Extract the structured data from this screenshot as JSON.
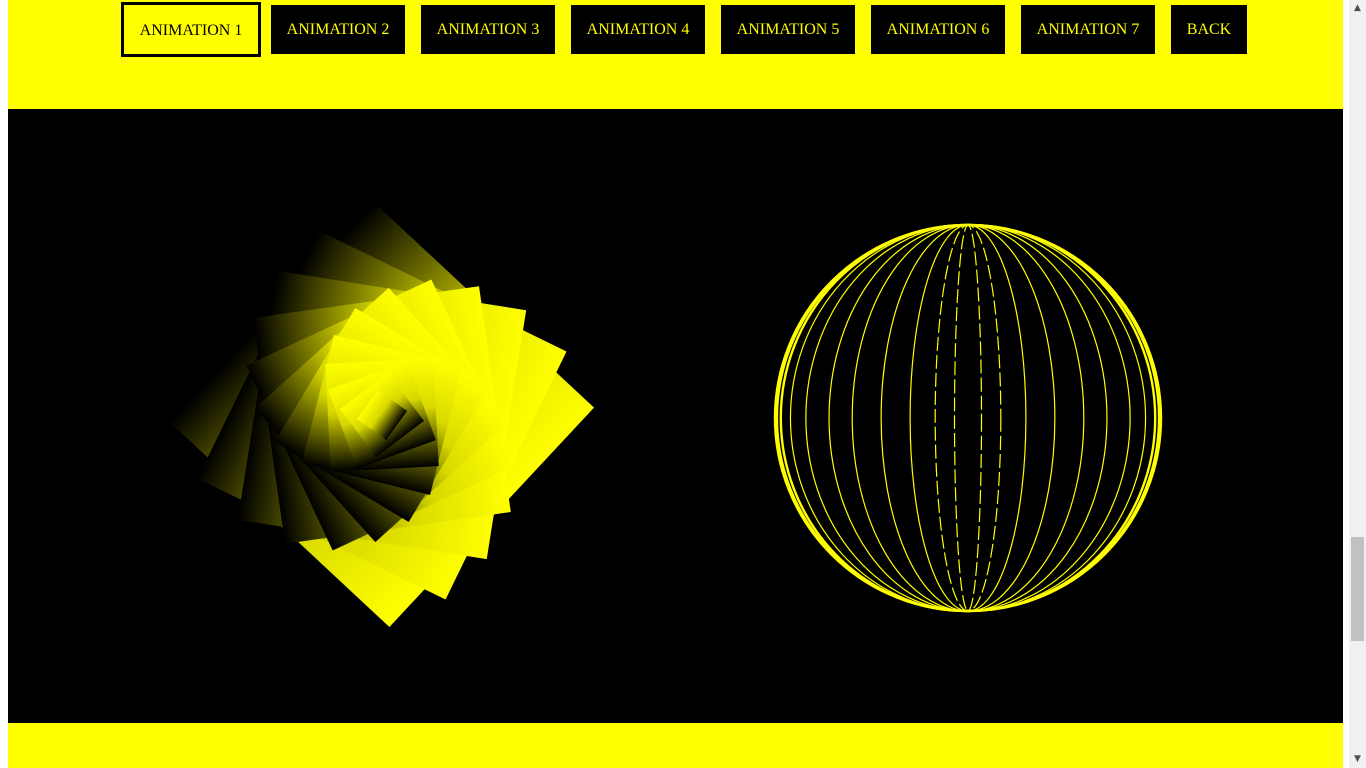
{
  "nav": {
    "buttons": [
      {
        "label": "ANIMATION 1",
        "active": true
      },
      {
        "label": "ANIMATION 2",
        "active": false
      },
      {
        "label": "ANIMATION 3",
        "active": false
      },
      {
        "label": "ANIMATION 4",
        "active": false
      },
      {
        "label": "ANIMATION 5",
        "active": false
      },
      {
        "label": "ANIMATION 6",
        "active": false
      },
      {
        "label": "ANIMATION 7",
        "active": false
      },
      {
        "label": "BACK",
        "active": false
      }
    ]
  },
  "colors": {
    "page_background": "#ffff00",
    "stage_background": "#000000",
    "accent": "#ffff00",
    "button_background": "#000000"
  },
  "stage": {
    "left_figure": "rotating-gradient-squares",
    "right_figure": "wireframe-sphere"
  },
  "scrollbar": {
    "up_icon": "triangle-up-icon",
    "down_icon": "triangle-down-icon"
  }
}
